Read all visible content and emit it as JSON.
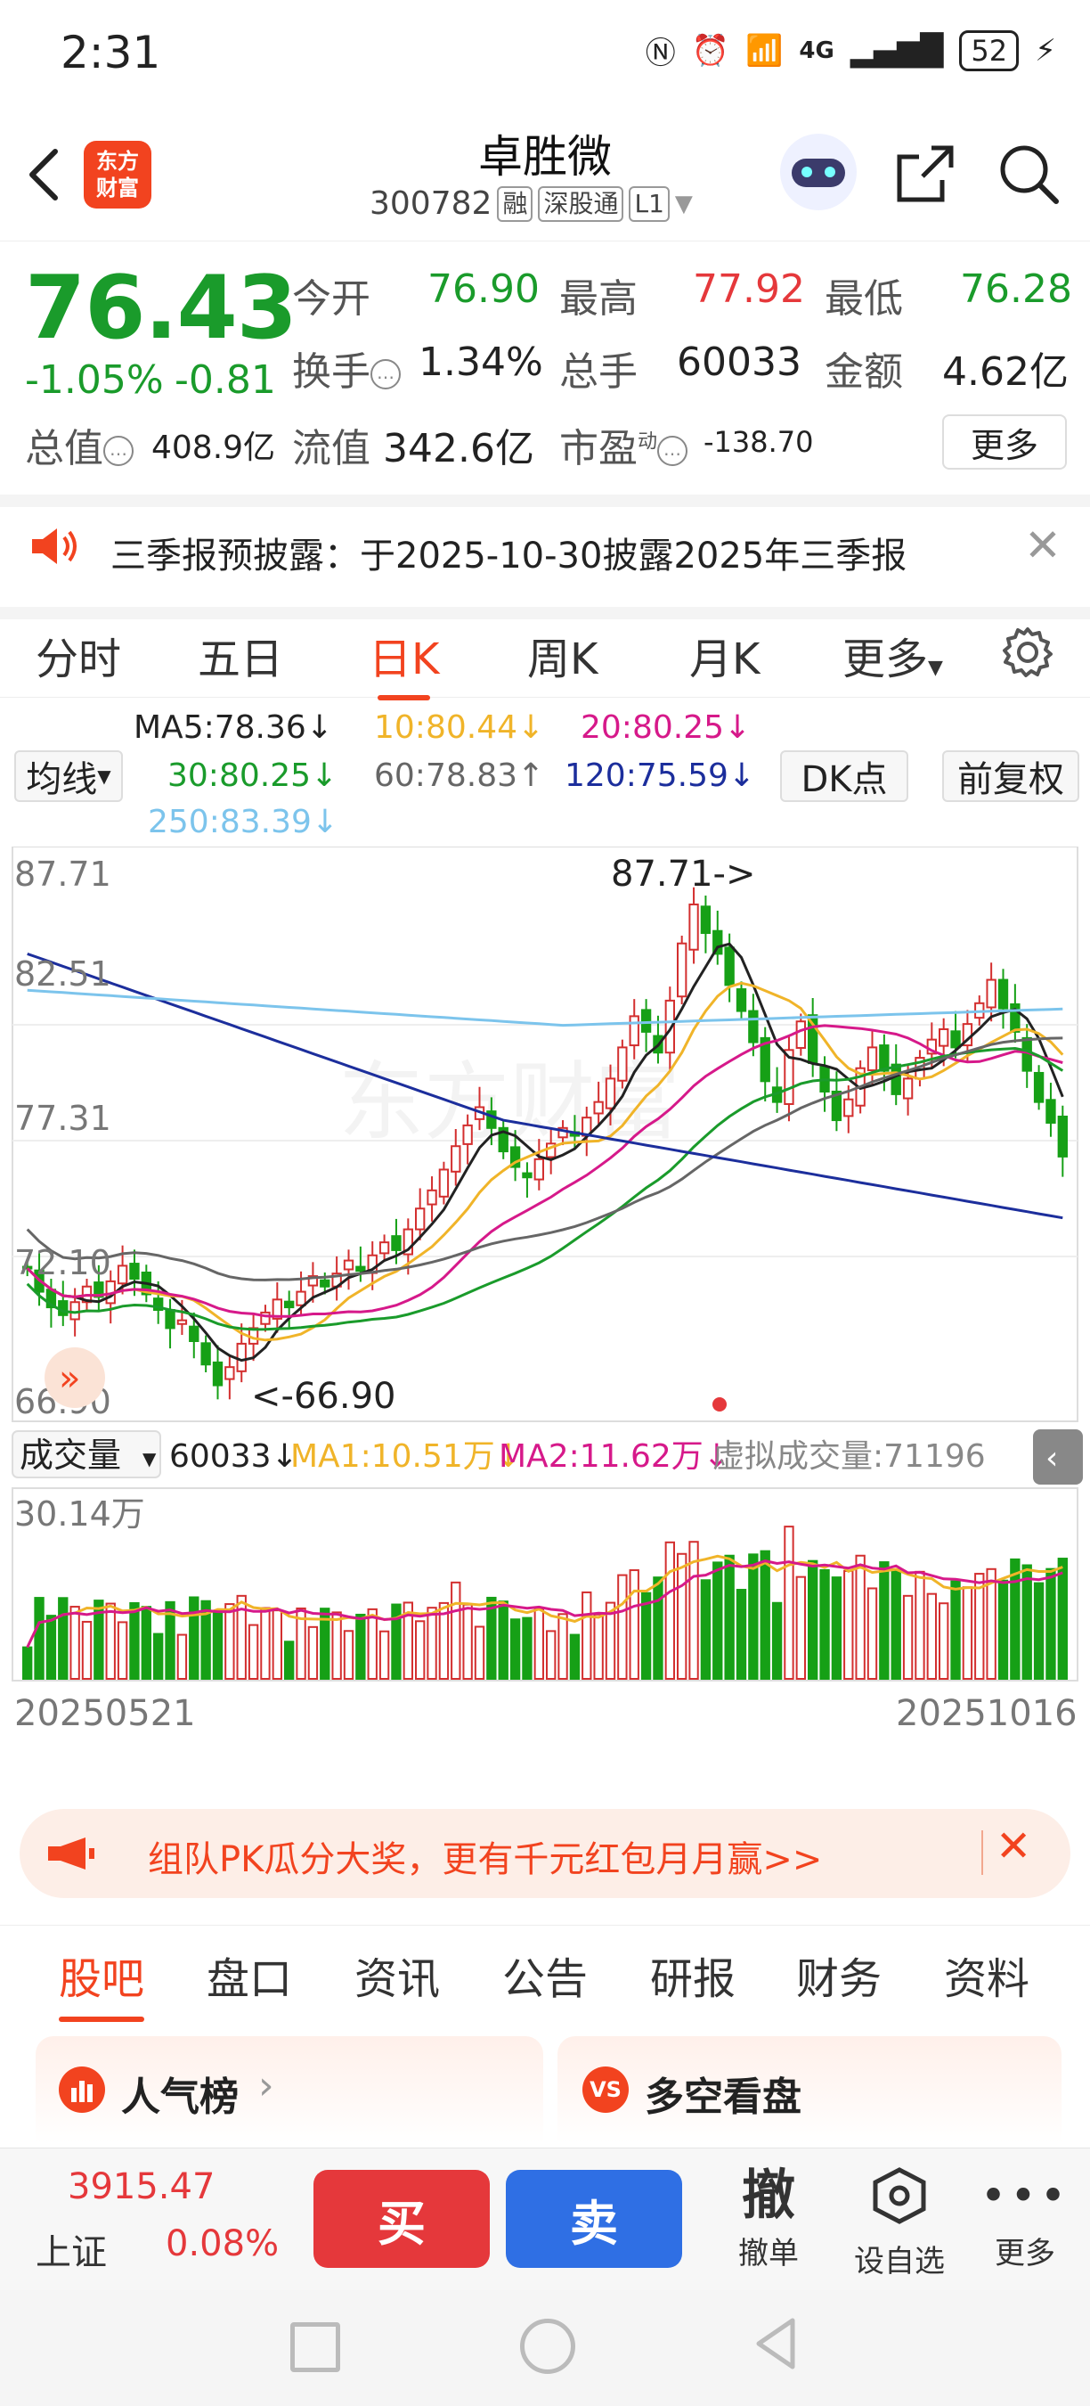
{
  "status_bar": {
    "time": "2:31",
    "network": "4G",
    "battery": "52"
  },
  "header": {
    "logo_line1": "东方",
    "logo_line2": "财富",
    "stock_name": "卓胜微",
    "stock_code": "300782",
    "tags": [
      "融",
      "深股通",
      "L1"
    ]
  },
  "quote": {
    "price": "76.43",
    "change_pct": "-1.05%",
    "change": "-0.81",
    "open_label": "今开",
    "open": "76.90",
    "high_label": "最高",
    "high": "77.92",
    "low_label": "最低",
    "low": "76.28",
    "turnover_label": "换手",
    "turnover": "1.34%",
    "volume_label": "总手",
    "volume": "60033",
    "amount_label": "金额",
    "amount": "4.62亿",
    "mktcap_label": "总值",
    "mktcap": "408.9亿",
    "float_label": "流值",
    "float_cap": "342.6亿",
    "pe_label": "市盈",
    "pe_sup": "动",
    "pe": "-138.70",
    "more_label": "更多"
  },
  "notice": {
    "text": "三季报预披露：于2025-10-30披露2025年三季报"
  },
  "kline_tabs": [
    "分时",
    "五日",
    "日K",
    "周K",
    "月K",
    "更多"
  ],
  "active_kline_tab": "日K",
  "ma_legend": {
    "indicator_btn": "均线",
    "ma5": "MA5:78.36↓",
    "ma10": "10:80.44↓",
    "ma20": "20:80.25↓",
    "ma30": "30:80.25↓",
    "ma60": "60:78.83↑",
    "ma120": "120:75.59↓",
    "ma250": "250:83.39↓",
    "dk_btn": "DK点",
    "adjust_btn": "前复权"
  },
  "colors": {
    "ma5": "#222222",
    "ma10": "#f0b429",
    "ma20": "#d6198a",
    "ma30": "#1a9b2b",
    "ma60": "#666666",
    "ma120": "#1c2e9c",
    "ma250": "#7cc4ec",
    "up": "#d32f2f",
    "down": "#16a016",
    "accent": "#f2431f",
    "buy": "#e5383b",
    "sell": "#2f6fe4"
  },
  "chart_data": {
    "type": "candlestick",
    "y_ticks": [
      "87.71",
      "82.51",
      "77.31",
      "72.10",
      "66.90"
    ],
    "ylim": [
      66.9,
      87.71
    ],
    "max_label": "87.71->",
    "min_label": "<-66.90",
    "start_date": "20250521",
    "end_date": "20251016",
    "closes": [
      72.1,
      71.2,
      70.6,
      70.3,
      70.8,
      71.4,
      71.0,
      71.6,
      72.2,
      71.7,
      71.1,
      70.5,
      69.8,
      70.1,
      69.3,
      68.4,
      67.6,
      68.3,
      69.2,
      69.8,
      70.4,
      70.9,
      70.6,
      71.2,
      71.8,
      71.4,
      71.9,
      72.4,
      72.0,
      72.6,
      73.1,
      72.8,
      73.6,
      74.4,
      75.1,
      75.9,
      76.8,
      77.6,
      78.3,
      77.5,
      76.6,
      76.0,
      75.6,
      76.3,
      76.9,
      77.5,
      77.2,
      77.9,
      78.5,
      79.4,
      80.6,
      81.8,
      81.2,
      80.4,
      82.4,
      84.6,
      86.1,
      85.0,
      84.2,
      83.0,
      82.0,
      80.8,
      79.3,
      78.5,
      80.5,
      81.6,
      80.0,
      78.9,
      77.8,
      78.6,
      79.8,
      80.6,
      79.7,
      78.8,
      79.4,
      80.2,
      80.9,
      81.3,
      80.6,
      81.5,
      82.3,
      83.2,
      82.1,
      81.2,
      79.7,
      78.5,
      77.7,
      76.4
    ],
    "volume_ylim": [
      0,
      30.14
    ],
    "volume_max_label": "30.14万",
    "volume_legend": {
      "selector": "成交量",
      "vol": "60033↓",
      "ma1": "MA1:10.51万↓",
      "ma2": "MA2:11.62万↓",
      "virtual": "虚拟成交量:71196"
    }
  },
  "banner": {
    "text": "组队PK瓜分大奖，更有千元红包月月赢>>"
  },
  "bottom_tabs": [
    "股吧",
    "盘口",
    "资讯",
    "公告",
    "研报",
    "财务",
    "资料"
  ],
  "active_bottom_tab": "股吧",
  "cards": [
    {
      "title": "人气榜"
    },
    {
      "title": "多空看盘"
    }
  ],
  "action_bar": {
    "index_value": "3915.47",
    "index_name": "上证",
    "index_change": "0.08%",
    "buy_label": "买",
    "sell_label": "卖",
    "cancel_icon_text": "撤",
    "cancel_label": "撤单",
    "watch_label": "设自选",
    "more_label": "更多"
  }
}
